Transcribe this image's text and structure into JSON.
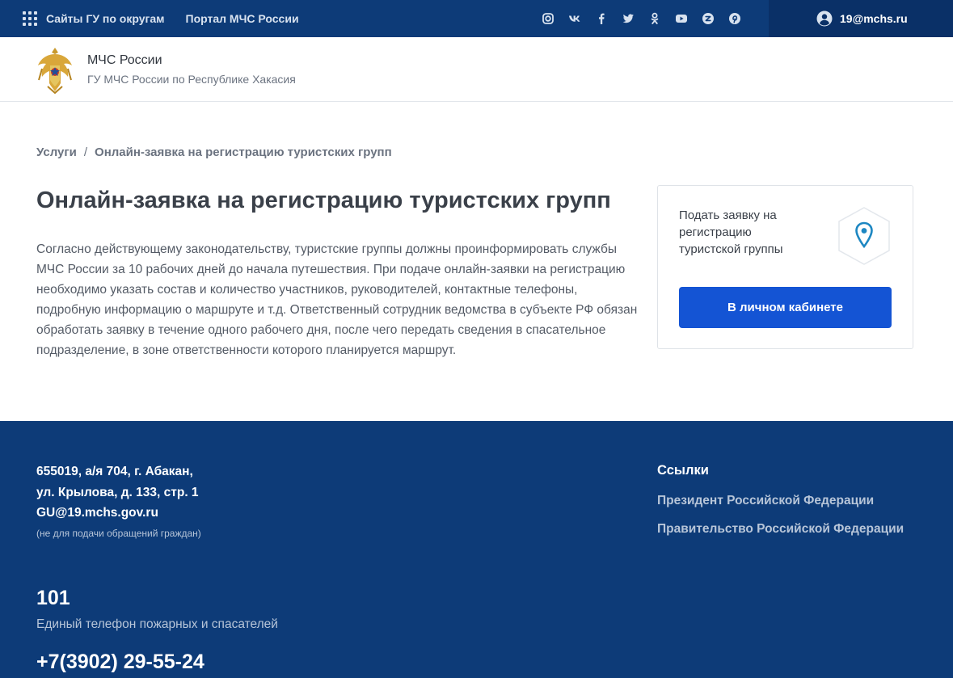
{
  "topbar": {
    "regions_label": "Сайты ГУ по округам",
    "portal_label": "Портал МЧС России",
    "socials": [
      "instagram-icon",
      "vk-icon",
      "facebook-icon",
      "twitter-icon",
      "odnoklassniki-icon",
      "youtube-icon",
      "zen-icon",
      "pinterest-icon"
    ],
    "user_email": "19@mchs.ru"
  },
  "header": {
    "title": "МЧС России",
    "subtitle": "ГУ МЧС России по Республике Хакасия"
  },
  "breadcrumb": {
    "root": "Услуги",
    "separator": "/",
    "current": "Онлайн-заявка на регистрацию туристских групп"
  },
  "main": {
    "title": "Онлайн-заявка на регистрацию туристских групп",
    "description": "Согласно действующему законодательству, туристские группы должны проинформировать службы МЧС России за 10 рабочих дней до начала путешествия. При подаче онлайн-заявки на регистрацию необходимо указать состав и количество участников, руководителей, контактные телефоны, подробную информацию о маршруте и т.д. Ответственный сотрудник ведомства в субъекте РФ обязан обработать заявку в течение одного рабочего дня, после чего передать сведения в спасательное подразделение, в зоне ответственности которого планируется маршрут."
  },
  "card": {
    "text": "Подать заявку на регистрацию туристской группы",
    "button_label": "В личном кабинете"
  },
  "footer": {
    "address_line1": "655019, а/я 704, г. Абакан,",
    "address_line2": "ул. Крылова, д. 133, стр. 1",
    "email": "GU@19.mchs.gov.ru",
    "email_note": "(не для подачи обращений граждан)",
    "links_title": "Ссылки",
    "link_president": "Президент Российской Федерации",
    "link_government": "Правительство Российской Федерации",
    "phone_emergency": "101",
    "phone_emergency_label": "Единый телефон пожарных и спасателей",
    "phone_main": "+7(3902) 29-55-24"
  },
  "colors": {
    "topbar_bg": "#0d3b78",
    "user_area_bg": "#0a3067",
    "button_bg": "#1454d4",
    "footer_bg": "#0d3b78",
    "muted_text": "#b7c5d8"
  }
}
